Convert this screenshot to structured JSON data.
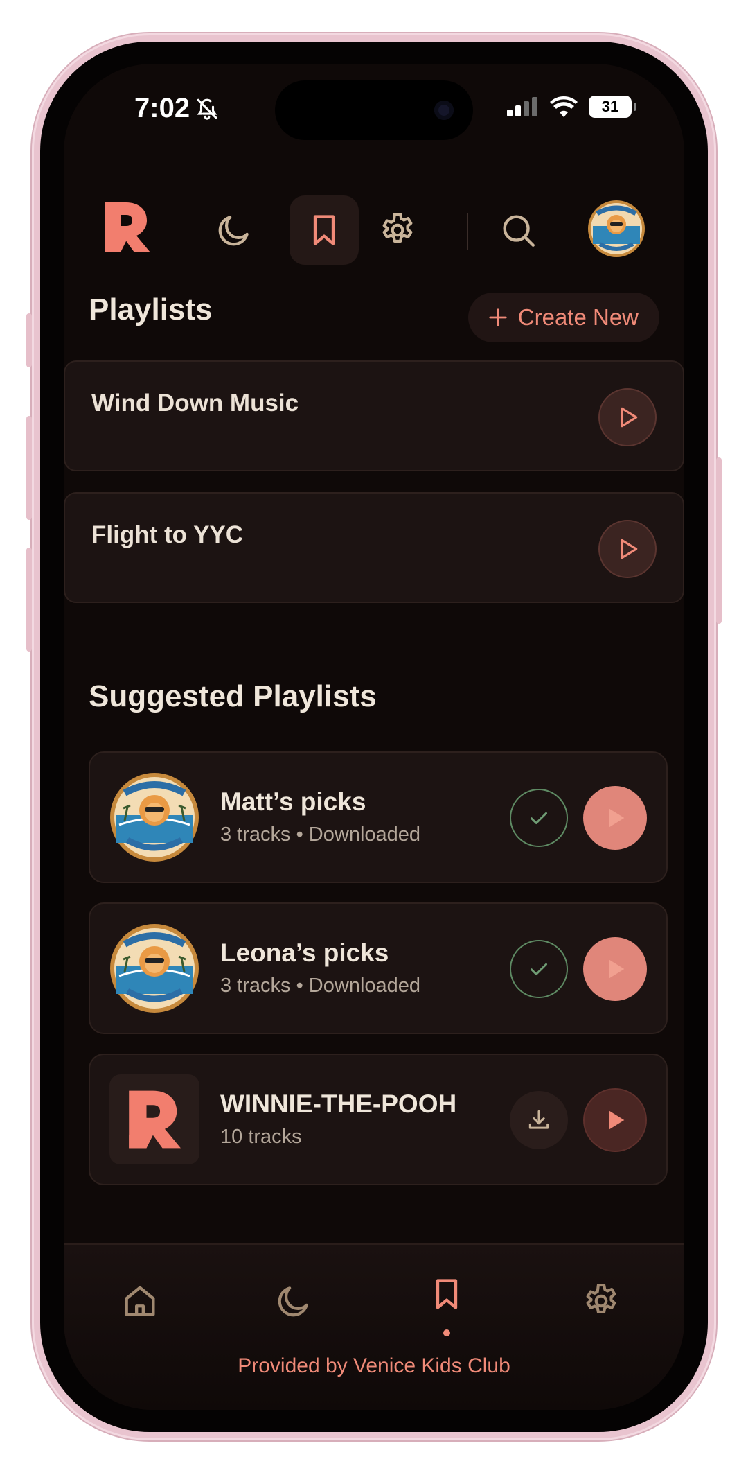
{
  "status_bar": {
    "time": "7:02",
    "battery": "31"
  },
  "header": {
    "logo_letter": "R"
  },
  "avatar_label": "VENICE KID'S CLUB",
  "playlists": {
    "title": "Playlists",
    "create_label": "Create New",
    "items": [
      {
        "name": "Wind Down Music"
      },
      {
        "name": "Flight to YYC"
      }
    ]
  },
  "suggested": {
    "title": "Suggested Playlists",
    "items": [
      {
        "title": "Matt’s picks",
        "subtitle": "3 tracks • Downloaded",
        "status": "downloaded",
        "thumb": "venice-kids-club-badge"
      },
      {
        "title": "Leona’s picks",
        "subtitle": "3 tracks • Downloaded",
        "status": "downloaded",
        "thumb": "venice-kids-club-badge"
      },
      {
        "title": "WINNIE-THE-POOH",
        "subtitle": "10 tracks",
        "status": "not-downloaded",
        "thumb": "r-logo"
      }
    ]
  },
  "tabbar": {
    "tabs": [
      "home-icon",
      "moon-icon",
      "bookmark-icon",
      "gear-icon"
    ],
    "active": "bookmark-icon",
    "footer": "Provided by Venice Kids Club"
  },
  "colors": {
    "accent": "#f08a78",
    "background": "#0f0908",
    "card": "#1c1312",
    "downloaded_green": "#5e8a63",
    "icon_muted": "#c9b49a"
  }
}
